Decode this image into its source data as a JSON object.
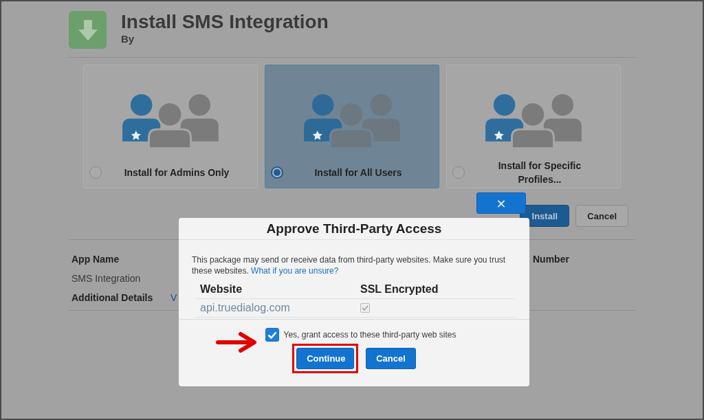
{
  "page": {
    "title": "Install SMS Integration",
    "byline": "By"
  },
  "install_options": [
    {
      "label": "Install for Admins Only",
      "selected": false
    },
    {
      "label": "Install for All Users",
      "selected": true
    },
    {
      "label": "Install for Specific Profiles...",
      "selected": false
    }
  ],
  "actions": [
    "Install",
    "Cancel"
  ],
  "details": {
    "app_name_label": "App Name",
    "app_name": "SMS Integration",
    "number_label": "Number",
    "additional_details_label": "Additional Details",
    "additional_details_link": "V"
  },
  "dialog": {
    "close": "×",
    "title": "Approve Third-Party Access",
    "message": "This package may send or receive data from third-party websites. Make sure you trust these websites.",
    "help_link": "What if you are unsure?",
    "columns": [
      "Website",
      "SSL Encrypted"
    ],
    "rows": [
      {
        "website": "api.truedialog.com",
        "ssl_encrypted": true
      }
    ],
    "grant": {
      "label": "Yes, grant access to these third-party web sites",
      "checked": true
    },
    "buttons": [
      "Continue",
      "Cancel"
    ]
  }
}
